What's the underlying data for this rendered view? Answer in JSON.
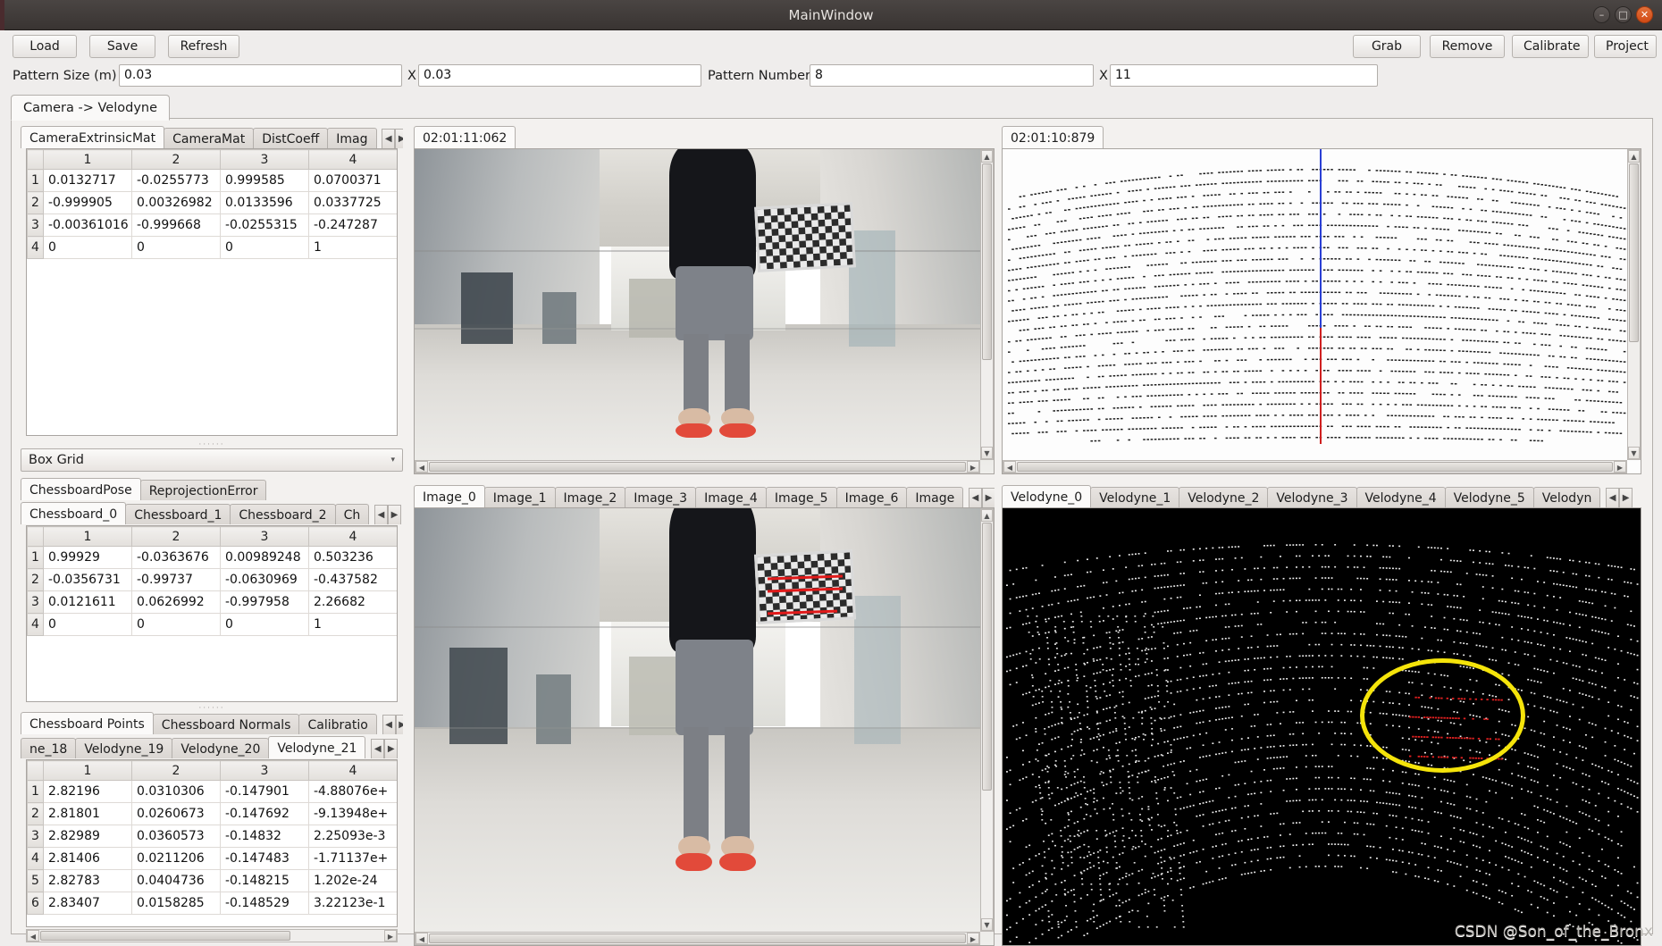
{
  "window": {
    "title": "MainWindow",
    "controls": {
      "minimize": "–",
      "maximize": "□",
      "close": "✕"
    }
  },
  "toolbar": {
    "left_buttons": [
      {
        "label": "Load"
      },
      {
        "label": "Save"
      },
      {
        "label": "Refresh"
      }
    ],
    "right_buttons": [
      {
        "label": "Grab"
      },
      {
        "label": "Remove"
      },
      {
        "label": "Calibrate"
      },
      {
        "label": "Project"
      }
    ]
  },
  "pattern_row": {
    "size_label": "Pattern Size (m)",
    "size_value_1": "0.03",
    "size_x_label": "X",
    "size_value_2": "0.03",
    "number_label": "Pattern Number",
    "number_value_1": "8",
    "number_x_label": "X",
    "number_value_2": "11"
  },
  "main_tabs": [
    {
      "label": "Camera -> Velodyne",
      "active": true
    }
  ],
  "calib_panel": {
    "tabs": [
      {
        "label": "CameraExtrinsicMat",
        "active": true
      },
      {
        "label": "CameraMat",
        "active": false
      },
      {
        "label": "DistCoeff",
        "active": false
      },
      {
        "label": "Imag",
        "active": false
      }
    ],
    "nav_left": "◀",
    "nav_right": "▶",
    "columns": [
      "1",
      "2",
      "3",
      "4"
    ],
    "rows": [
      {
        "index": "1",
        "cells": [
          "0.0132717",
          "-0.0255773",
          "0.999585",
          "0.0700371"
        ]
      },
      {
        "index": "2",
        "cells": [
          "-0.999905",
          "0.00326982",
          "0.0133596",
          "0.0337725"
        ]
      },
      {
        "index": "3",
        "cells": [
          "-0.00361016",
          "-0.999668",
          "-0.0255315",
          "-0.247287"
        ]
      },
      {
        "index": "4",
        "cells": [
          "0",
          "0",
          "0",
          "1"
        ]
      }
    ]
  },
  "grid_combo": {
    "value": "Box Grid",
    "arrow": "▾"
  },
  "pose_panel": {
    "tabs": [
      {
        "label": "ChessboardPose",
        "active": true
      },
      {
        "label": "ReprojectionError",
        "active": false
      }
    ],
    "subtabs": [
      {
        "label": "Chessboard_0",
        "active": true
      },
      {
        "label": "Chessboard_1",
        "active": false
      },
      {
        "label": "Chessboard_2",
        "active": false
      },
      {
        "label": "Ch",
        "active": false
      }
    ],
    "nav_left": "◀",
    "nav_right": "▶",
    "columns": [
      "1",
      "2",
      "3",
      "4"
    ],
    "rows": [
      {
        "index": "1",
        "cells": [
          "0.99929",
          "-0.0363676",
          "0.00989248",
          "0.503236"
        ]
      },
      {
        "index": "2",
        "cells": [
          "-0.0356731",
          "-0.99737",
          "-0.0630969",
          "-0.437582"
        ]
      },
      {
        "index": "3",
        "cells": [
          "0.0121611",
          "0.0626992",
          "-0.997958",
          "2.26682"
        ]
      },
      {
        "index": "4",
        "cells": [
          "0",
          "0",
          "0",
          "1"
        ]
      }
    ]
  },
  "points_panel": {
    "tabs": [
      {
        "label": "Chessboard Points",
        "active": true
      },
      {
        "label": "Chessboard Normals",
        "active": false
      },
      {
        "label": "Calibratio",
        "active": false
      }
    ],
    "subtabs": [
      {
        "label": "ne_18",
        "active": false
      },
      {
        "label": "Velodyne_19",
        "active": false
      },
      {
        "label": "Velodyne_20",
        "active": false
      },
      {
        "label": "Velodyne_21",
        "active": true
      }
    ],
    "nav_left": "◀",
    "nav_right": "▶",
    "columns": [
      "1",
      "2",
      "3",
      "4"
    ],
    "rows": [
      {
        "index": "1",
        "cells": [
          "2.82196",
          "0.0310306",
          "-0.147901",
          "-4.88076e+"
        ]
      },
      {
        "index": "2",
        "cells": [
          "2.81801",
          "0.0260673",
          "-0.147692",
          "-9.13948e+"
        ]
      },
      {
        "index": "3",
        "cells": [
          "2.82989",
          "0.0360573",
          "-0.14832",
          "2.25093e-3"
        ]
      },
      {
        "index": "4",
        "cells": [
          "2.81406",
          "0.0211206",
          "-0.147483",
          "-1.71137e+"
        ]
      },
      {
        "index": "5",
        "cells": [
          "2.82783",
          "0.0404736",
          "-0.148215",
          "1.202e-24"
        ]
      },
      {
        "index": "6",
        "cells": [
          "2.83407",
          "0.0158285",
          "-0.148529",
          "3.22123e-1"
        ]
      }
    ]
  },
  "camera_view": {
    "timestamp_tab": "02:01:11:062"
  },
  "lidar_view": {
    "timestamp_tab": "02:01:10:879"
  },
  "image_tabs": [
    {
      "label": "Image_0",
      "active": true
    },
    {
      "label": "Image_1",
      "active": false
    },
    {
      "label": "Image_2",
      "active": false
    },
    {
      "label": "Image_3",
      "active": false
    },
    {
      "label": "Image_4",
      "active": false
    },
    {
      "label": "Image_5",
      "active": false
    },
    {
      "label": "Image_6",
      "active": false
    },
    {
      "label": "Image",
      "active": false
    }
  ],
  "velodyne_tabs": [
    {
      "label": "Velodyne_0",
      "active": true
    },
    {
      "label": "Velodyne_1",
      "active": false
    },
    {
      "label": "Velodyne_2",
      "active": false
    },
    {
      "label": "Velodyne_3",
      "active": false
    },
    {
      "label": "Velodyne_4",
      "active": false
    },
    {
      "label": "Velodyne_5",
      "active": false
    },
    {
      "label": "Velodyn",
      "active": false
    }
  ],
  "watermark": "CSDN @Son_of_the_Bronx",
  "colors": {
    "accent_highlight": "#f5e40a",
    "projected_points": "#e02020",
    "window_bg": "#efedec",
    "titlebar": "#3c3735",
    "close_button": "#d24a15"
  }
}
